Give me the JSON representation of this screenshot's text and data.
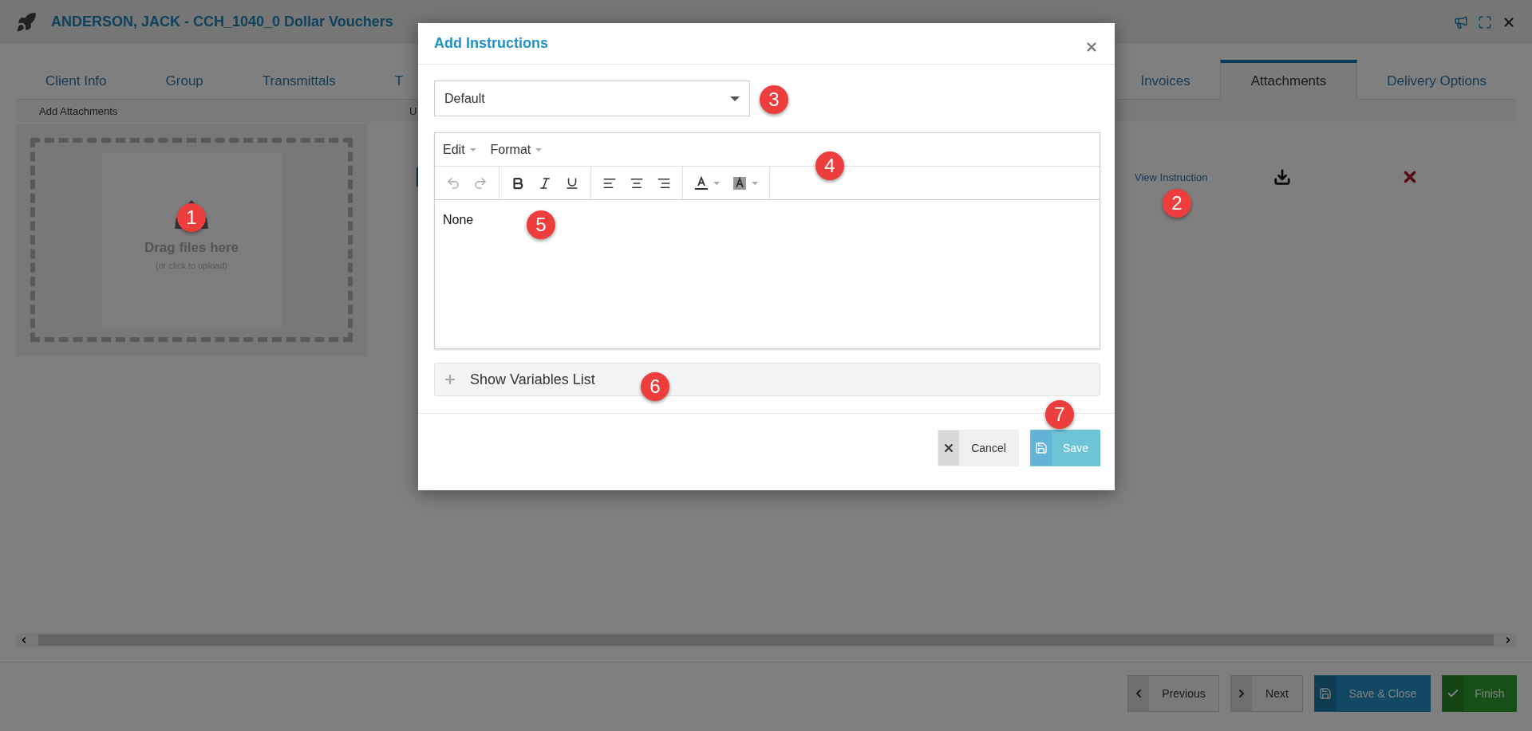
{
  "header": {
    "title": "ANDERSON, JACK - CCH_1040_0 Dollar Vouchers"
  },
  "tabs": {
    "left": [
      {
        "label": "Client Info",
        "selected": false
      },
      {
        "label": "Group",
        "selected": false
      },
      {
        "label": "Transmittals",
        "selected": false
      },
      {
        "label": "T",
        "selected": false
      }
    ],
    "right": [
      {
        "label": "Invoices",
        "selected": false
      },
      {
        "label": "Attachments",
        "selected": true
      },
      {
        "label": "Delivery Options",
        "selected": false
      }
    ]
  },
  "panel_headers": [
    "Add Attachments",
    "U"
  ],
  "dropzone": {
    "title": "Drag files here",
    "hint": "(or click to upload)"
  },
  "attachment_row": {
    "link": "View Instruction"
  },
  "footer_buttons": [
    {
      "label": "Previous",
      "kind": "previous"
    },
    {
      "label": "Next",
      "kind": "next"
    },
    {
      "label": "Save & Close",
      "kind": "save"
    },
    {
      "label": "Finish",
      "kind": "finish"
    }
  ],
  "modal": {
    "title": "Add Instructions",
    "template_select": {
      "value": "Default"
    },
    "editor": {
      "menus": [
        "Edit",
        "Format"
      ],
      "toolbar": [
        {
          "kind": "undo",
          "disabled": true
        },
        {
          "kind": "redo",
          "disabled": true
        },
        {
          "kind": "bold",
          "disabled": false
        },
        {
          "kind": "italic",
          "disabled": false
        },
        {
          "kind": "underline",
          "disabled": false
        },
        {
          "kind": "align-left",
          "disabled": false
        },
        {
          "kind": "align-center",
          "disabled": false
        },
        {
          "kind": "align-right",
          "disabled": false
        },
        {
          "kind": "text-color",
          "disabled": false
        },
        {
          "kind": "background-color",
          "disabled": false
        }
      ],
      "content": "None"
    },
    "variables_panel": {
      "label": "Show Variables List",
      "expanded": false
    },
    "buttons": [
      {
        "label": "Cancel",
        "kind": "cancel"
      },
      {
        "label": "Save",
        "kind": "save"
      }
    ]
  },
  "callouts": [
    "1",
    "2",
    "3",
    "4",
    "5",
    "6",
    "7"
  ]
}
